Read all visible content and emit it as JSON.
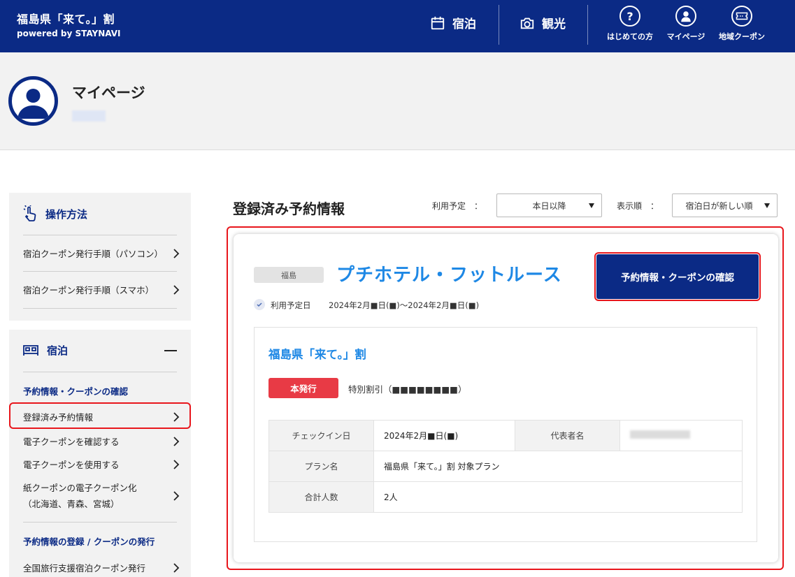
{
  "header": {
    "logo_title": "福島県「来て。」割",
    "logo_sub": "powered by STAYNAVI",
    "nav_stay": "宿泊",
    "nav_tour": "観光",
    "nav_help": "はじめての方",
    "nav_mypage": "マイページ",
    "nav_coupon": "地域クーポン",
    "accent_color": "#0b2a85"
  },
  "profile": {
    "title": "マイページ"
  },
  "sidebar": {
    "howto": {
      "title": "操作方法",
      "items": [
        "宿泊クーポン発行手順（パソコン）",
        "宿泊クーポン発行手順（スマホ）"
      ]
    },
    "stay": {
      "title": "宿泊",
      "section1_label": "予約情報・クーポンの確認",
      "items": [
        "登録済み予約情報",
        "電子クーポンを確認する",
        "電子クーポンを使用する"
      ],
      "paper_line1": "紙クーポンの電子クーポン化",
      "paper_line2": "（北海道、青森、宮城）",
      "section2_label": "予約情報の登録 / クーポンの発行",
      "item_national": "全国旅行支援宿泊クーポン発行"
    }
  },
  "main": {
    "title": "登録済み予約情報",
    "filter_usage_label": "利用予定　：",
    "filter_usage_value": "本日以降",
    "filter_sort_label": "表示順　：",
    "filter_sort_value": "宿泊日が新しい順"
  },
  "reservation": {
    "area": "福島",
    "hotel_name": "プチホテル・フットルース",
    "confirm_button": "予約情報・クーポンの確認",
    "date_label": "利用予定日",
    "date_value": "2024年2月■日(■)〜2024年2月■日(■)",
    "campaign_title": "福島県「来て。」割",
    "status_badge": "本発行",
    "discount_label": "特別割引（■■■■■■■■）",
    "details": {
      "checkin_label": "チェックイン日",
      "checkin_value": "2024年2月■日(■)",
      "rep_label": "代表者名",
      "plan_label": "プラン名",
      "plan_value": "福島県「来て。」割 対象プラン",
      "people_label": "合計人数",
      "people_value": "2人"
    }
  }
}
